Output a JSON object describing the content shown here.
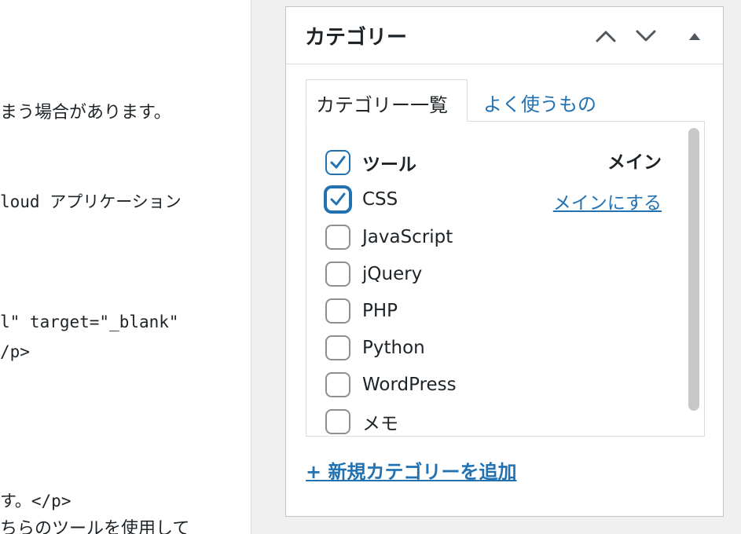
{
  "editor": {
    "lines": [
      "まう場合があります。",
      "loud アプリケーション",
      "l\" target=\"_blank\"",
      "/p>",
      "す。</p>",
      "ちらのツールを使用して"
    ]
  },
  "panel": {
    "title": "カテゴリー",
    "move_up_label": "up-chevron",
    "move_down_label": "down-chevron",
    "toggle_label": "collapse-triangle",
    "tabs": {
      "all": "カテゴリー一覧",
      "popular": "よく使うもの"
    },
    "categories": [
      {
        "name": "ツール",
        "checked": true,
        "primary": true
      },
      {
        "name": "CSS",
        "checked": true,
        "primary": false
      },
      {
        "name": "JavaScript",
        "checked": false
      },
      {
        "name": "jQuery",
        "checked": false
      },
      {
        "name": "PHP",
        "checked": false
      },
      {
        "name": "Python",
        "checked": false
      },
      {
        "name": "WordPress",
        "checked": false
      },
      {
        "name": "メモ",
        "checked": false
      }
    ],
    "primary_text": "メイン",
    "make_primary_text": "メインにする",
    "add_new": "+ 新規カテゴリーを追加"
  },
  "colors": {
    "accent": "#2271b1",
    "border": "#dcdcde",
    "scrollbar": "#c6c7c9"
  }
}
